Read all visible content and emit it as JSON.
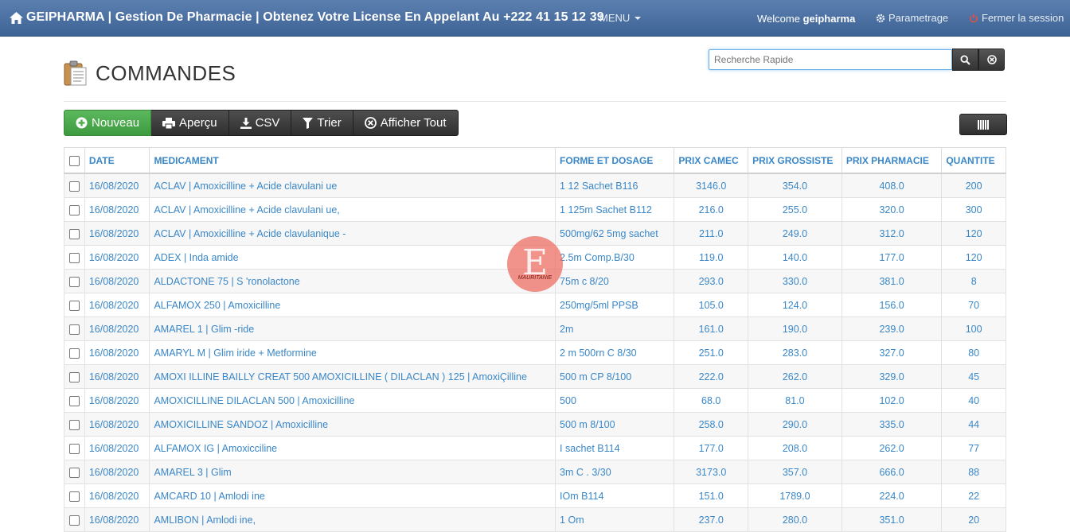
{
  "navbar": {
    "brand": "GEIPHARMA | Gestion De Pharmacie | Obtenez Votre License En Appelant Au +222 41 15 12 39",
    "menu_label": "MENU",
    "welcome_prefix": "Welcome",
    "welcome_user": "geipharma",
    "settings_label": "Parametrage",
    "logout_label": "Fermer la session"
  },
  "page": {
    "title": "COMMANDES"
  },
  "search": {
    "placeholder": "Recherche Rapide"
  },
  "toolbar": {
    "new_label": "Nouveau",
    "preview_label": "Aperçu",
    "csv_label": "CSV",
    "sort_label": "Trier",
    "show_all_label": "Afficher Tout"
  },
  "table": {
    "headers": {
      "date": "DATE",
      "medicament": "MEDICAMENT",
      "forme": "FORME ET DOSAGE",
      "prix_camec": "PRIX CAMEC",
      "prix_grossiste": "PRIX GROSSISTE",
      "prix_pharmacie": "PRIX PHARMACIE",
      "quantite": "QUANTITE"
    },
    "rows": [
      {
        "date": "16/08/2020",
        "medicament": "ACLAV | Amoxicilline + Acide clavulani ue",
        "forme": "1 12 Sachet B116",
        "camec": "3146.0",
        "grossiste": "354.0",
        "pharmacie": "408.0",
        "quantite": "200"
      },
      {
        "date": "16/08/2020",
        "medicament": "ACLAV | Amoxicilline + Acide clavulani ue,",
        "forme": "1 125m Sachet B112",
        "camec": "216.0",
        "grossiste": "255.0",
        "pharmacie": "320.0",
        "quantite": "300"
      },
      {
        "date": "16/08/2020",
        "medicament": "ACLAV | Amoxicilline + Acide clavulanique -",
        "forme": "500mg/62 5mg sachet",
        "camec": "211.0",
        "grossiste": "249.0",
        "pharmacie": "312.0",
        "quantite": "120"
      },
      {
        "date": "16/08/2020",
        "medicament": "ADEX | Inda amide",
        "forme": "2.5m Comp.B/30",
        "camec": "119.0",
        "grossiste": "140.0",
        "pharmacie": "177.0",
        "quantite": "120"
      },
      {
        "date": "16/08/2020",
        "medicament": "ALDACTONE 75 | S 'ronolactone",
        "forme": "75m c 8/20",
        "camec": "293.0",
        "grossiste": "330.0",
        "pharmacie": "381.0",
        "quantite": "8"
      },
      {
        "date": "16/08/2020",
        "medicament": "ALFAMOX 250 | Amoxicilline",
        "forme": "250mg/5ml PPSB",
        "camec": "105.0",
        "grossiste": "124.0",
        "pharmacie": "156.0",
        "quantite": "70"
      },
      {
        "date": "16/08/2020",
        "medicament": "AMAREL 1 | Glim -ride",
        "forme": "2m",
        "camec": "161.0",
        "grossiste": "190.0",
        "pharmacie": "239.0",
        "quantite": "100"
      },
      {
        "date": "16/08/2020",
        "medicament": "AMARYL M | Glim iride + Metformine",
        "forme": "2 m 500rn C 8/30",
        "camec": "251.0",
        "grossiste": "283.0",
        "pharmacie": "327.0",
        "quantite": "80"
      },
      {
        "date": "16/08/2020",
        "medicament": "AMOXI ILLINE BAILLY CREAT 500 AMOXICILLINE ( DILACLAN ) 125 | AmoxiÇilline",
        "forme": "500 m CP 8/100",
        "camec": "222.0",
        "grossiste": "262.0",
        "pharmacie": "329.0",
        "quantite": "45"
      },
      {
        "date": "16/08/2020",
        "medicament": "AMOXICILLINE DILACLAN 500 | Amoxicilline",
        "forme": "500",
        "camec": "68.0",
        "grossiste": "81.0",
        "pharmacie": "102.0",
        "quantite": "40"
      },
      {
        "date": "16/08/2020",
        "medicament": "AMOXICILLINE SANDOZ | Amoxicilline",
        "forme": "500 m 8/100",
        "camec": "258.0",
        "grossiste": "290.0",
        "pharmacie": "335.0",
        "quantite": "44"
      },
      {
        "date": "16/08/2020",
        "medicament": "ALFAMOX IG | Amoxicciline",
        "forme": "I sachet B114",
        "camec": "177.0",
        "grossiste": "208.0",
        "pharmacie": "262.0",
        "quantite": "77"
      },
      {
        "date": "16/08/2020",
        "medicament": "AMAREL 3 | Glim",
        "forme": "3m C . 3/30",
        "camec": "3173.0",
        "grossiste": "357.0",
        "pharmacie": "666.0",
        "quantite": "88"
      },
      {
        "date": "16/08/2020",
        "medicament": "AMCARD 10 | Amlodi ine",
        "forme": "IOm B114",
        "camec": "151.0",
        "grossiste": "1789.0",
        "pharmacie": "224.0",
        "quantite": "22"
      },
      {
        "date": "16/08/2020",
        "medicament": "AMLIBON | Amlodi ine,",
        "forme": "1 Om",
        "camec": "237.0",
        "grossiste": "280.0",
        "pharmacie": "351.0",
        "quantite": "20"
      }
    ]
  },
  "watermark": {
    "letter": "E",
    "text": "MAURITANIE"
  }
}
